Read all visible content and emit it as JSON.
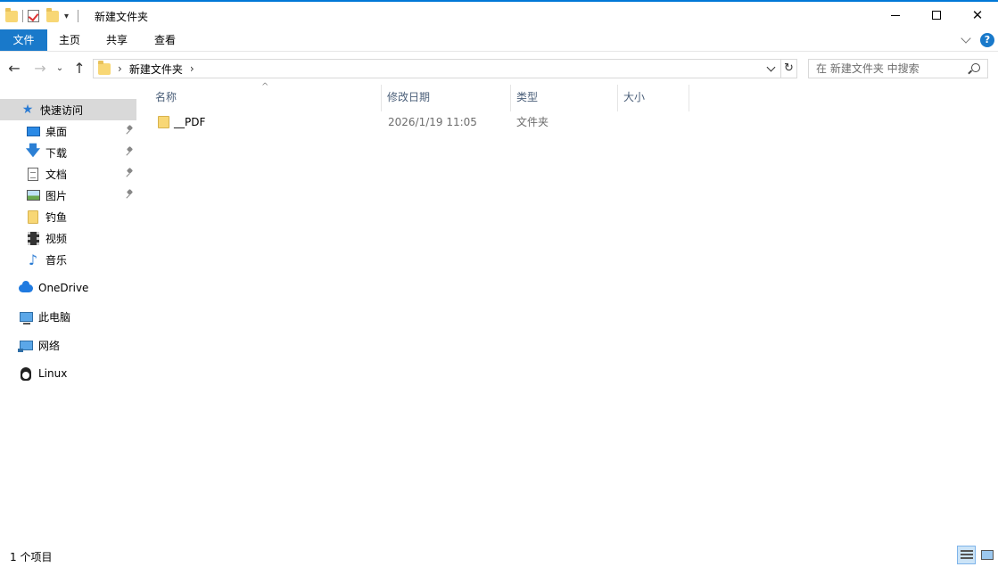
{
  "window": {
    "title": "新建文件夹",
    "accent": "#0078d7"
  },
  "ribbon": {
    "tabs": [
      {
        "label": "文件"
      },
      {
        "label": "主页"
      },
      {
        "label": "共享"
      },
      {
        "label": "查看"
      }
    ],
    "file_tab_color": "#1979ca"
  },
  "address": {
    "path": [
      "新建文件夹"
    ]
  },
  "search": {
    "placeholder": "在 新建文件夹 中搜索"
  },
  "nav_pane": {
    "quick_access": "快速访问",
    "quick_items": [
      {
        "label": "桌面",
        "icon": "desktop-icon",
        "pinned": true
      },
      {
        "label": "下载",
        "icon": "download-icon",
        "pinned": true
      },
      {
        "label": "文档",
        "icon": "document-icon",
        "pinned": true
      },
      {
        "label": "图片",
        "icon": "pictures-icon",
        "pinned": true
      },
      {
        "label": "钓鱼",
        "icon": "folder-icon",
        "pinned": false
      },
      {
        "label": "视频",
        "icon": "video-icon",
        "pinned": false
      },
      {
        "label": "音乐",
        "icon": "music-icon",
        "pinned": false
      }
    ],
    "onedrive": "OneDrive",
    "this_pc": "此电脑",
    "network": "网络",
    "linux": "Linux"
  },
  "columns": {
    "name": "名称",
    "date": "修改日期",
    "type": "类型",
    "size": "大小"
  },
  "files": [
    {
      "name": "__PDF",
      "date": "2026/1/19 11:05",
      "type": "文件夹",
      "size": ""
    }
  ],
  "status": {
    "count": "1 个项目"
  }
}
